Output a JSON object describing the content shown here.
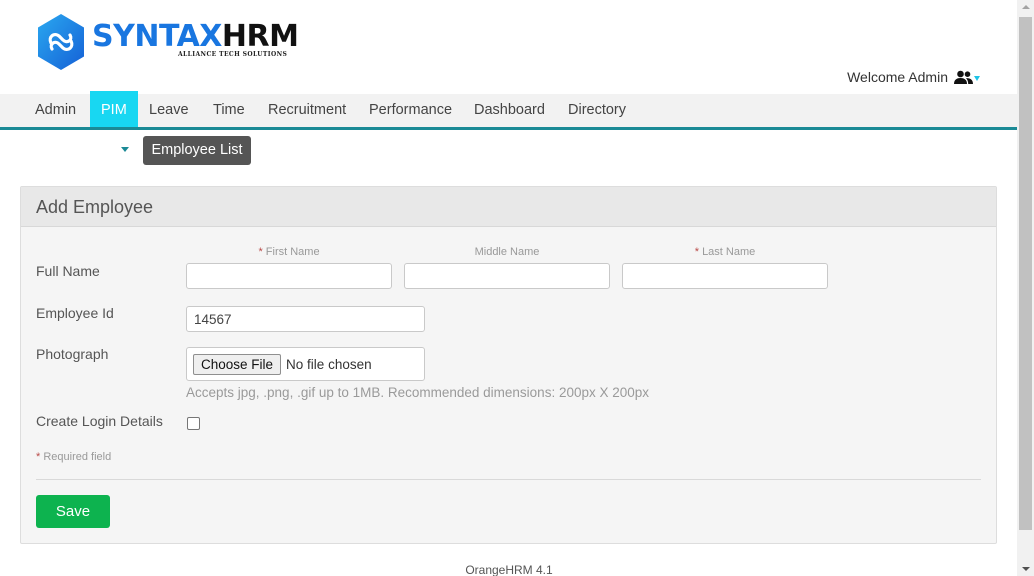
{
  "brand": {
    "name_part1": "SYNTAX",
    "name_part2": "HRM",
    "tagline": "ALLIANCE TECH SOLUTIONS",
    "primary_color": "#1976e0"
  },
  "header": {
    "welcome": "Welcome Admin",
    "user_icon": "users-icon",
    "caret_icon": "caret-down-icon"
  },
  "nav": {
    "items": [
      {
        "label": "Admin",
        "active": false
      },
      {
        "label": "PIM",
        "active": true
      },
      {
        "label": "Leave",
        "active": false
      },
      {
        "label": "Time",
        "active": false
      },
      {
        "label": "Recruitment",
        "active": false
      },
      {
        "label": "Performance",
        "active": false
      },
      {
        "label": "Dashboard",
        "active": false
      },
      {
        "label": "Directory",
        "active": false
      }
    ],
    "active_color": "#18d7f2",
    "underline_color": "#1b8a96"
  },
  "subnav": {
    "employee_list": "Employee List"
  },
  "form": {
    "title": "Add Employee",
    "full_name_label": "Full Name",
    "first_name_label": "First Name",
    "middle_name_label": "Middle Name",
    "last_name_label": "Last Name",
    "required_mark": "*",
    "first_name_value": "",
    "middle_name_value": "",
    "last_name_value": "",
    "employee_id_label": "Employee Id",
    "employee_id_value": "14567",
    "photograph_label": "Photograph",
    "choose_file_label": "Choose File",
    "no_file_text": "No file chosen",
    "photo_hint": "Accepts jpg, .png, .gif up to 1MB. Recommended dimensions: 200px X 200px",
    "create_login_label": "Create Login Details",
    "required_field_note": "Required field",
    "save_label": "Save",
    "save_color": "#0db34f"
  },
  "footer": {
    "version": "OrangeHRM 4.1"
  }
}
